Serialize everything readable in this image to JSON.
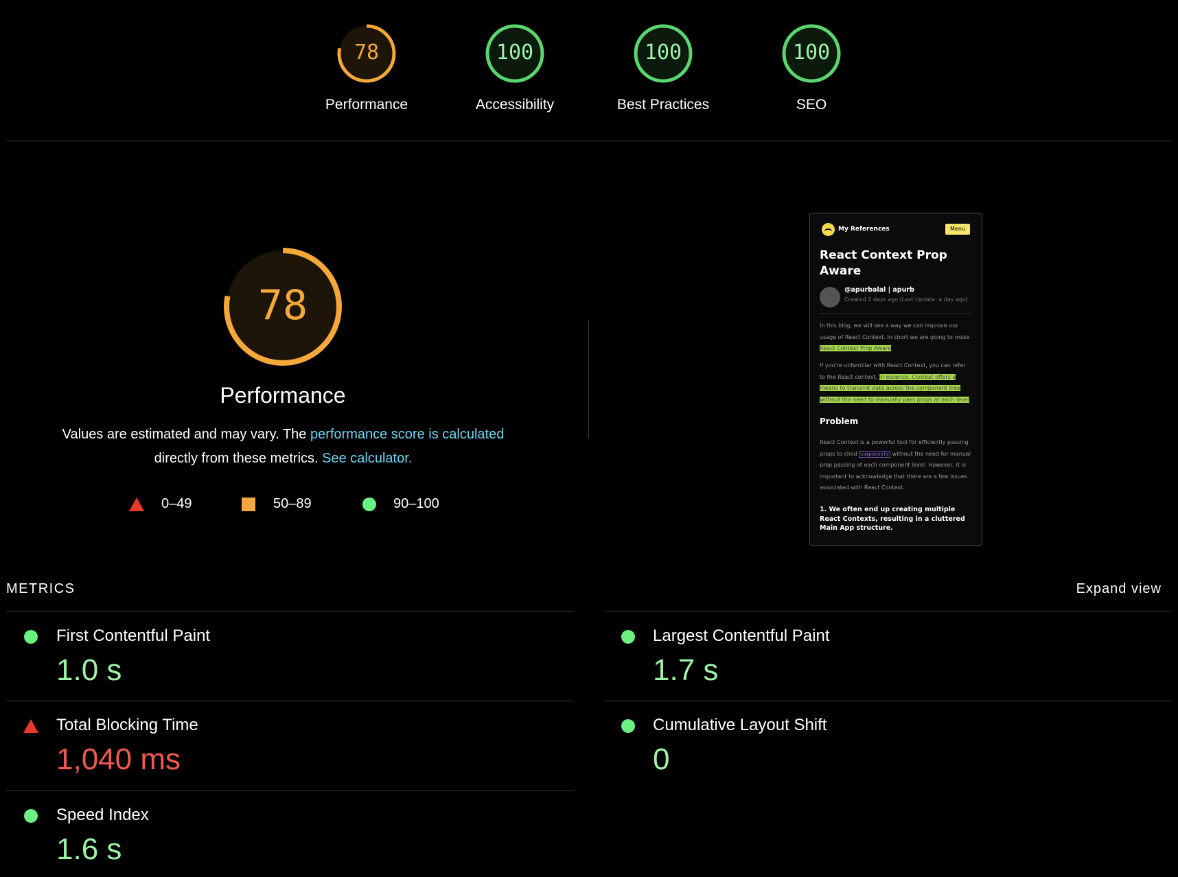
{
  "scores": [
    {
      "score": "78",
      "label": "Performance",
      "value": 78,
      "color": "#f4a83a",
      "bg": "#1e1509"
    },
    {
      "score": "100",
      "label": "Accessibility",
      "value": 100,
      "color": "#5ad66e",
      "bg": "#0b1a0d"
    },
    {
      "score": "100",
      "label": "Best Practices",
      "value": 100,
      "color": "#5ad66e",
      "bg": "#0b1a0d"
    },
    {
      "score": "100",
      "label": "SEO",
      "value": 100,
      "color": "#5ad66e",
      "bg": "#0b1a0d"
    }
  ],
  "main": {
    "score": "78",
    "value": 78,
    "title": "Performance",
    "desc_part1": "Values are estimated and may vary. The ",
    "desc_link1": "performance score is calculated",
    "desc_part2": "directly from these metrics. ",
    "desc_link2": "See calculator."
  },
  "legend": {
    "fail": "0–49",
    "average": "50–89",
    "pass": "90–100"
  },
  "thumbnail": {
    "brand": "My References",
    "menu": "Menu",
    "title": "React Context Prop Aware",
    "author": "@apurbalal | apurb",
    "created": "Created 2 days ago (Last Update: a day ago)",
    "p1_text": "In this blog, we will see a way we can improve our usage of React Context. In short we are going to make ",
    "p1_highlight": "React Context Prop Aware",
    "p2_text": "If you're unfamiliar with React Context, you can refer to the React context. ",
    "p2_highlight": "In essence, Context offers a means to transmit data across the component tree without the need to manually pass props at each level",
    "h2": "Problem",
    "p3_a": "React Context is a powerful tool for efficiently passing props to child ",
    "p3_code": "components",
    "p3_b": " without the need for manual prop passing at each component level. However, it is important to acknowledge that there are a few issues associated with React Context.",
    "bold": "1. We often end up creating multiple React Contexts, resulting in a cluttered Main App structure."
  },
  "metrics": {
    "heading": "METRICS",
    "expand": "Expand view",
    "fcp": {
      "name": "First Contentful Paint",
      "value": "1.0 s",
      "status": "pass"
    },
    "lcp": {
      "name": "Largest Contentful Paint",
      "value": "1.7 s",
      "status": "pass"
    },
    "tbt": {
      "name": "Total Blocking Time",
      "value": "1,040 ms",
      "status": "fail"
    },
    "cls": {
      "name": "Cumulative Layout Shift",
      "value": "0",
      "status": "pass"
    },
    "si": {
      "name": "Speed Index",
      "value": "1.6 s",
      "status": "pass"
    }
  },
  "colors": {
    "pass": "#6bf082",
    "average": "#f4a83a",
    "fail": "#e8392c"
  }
}
